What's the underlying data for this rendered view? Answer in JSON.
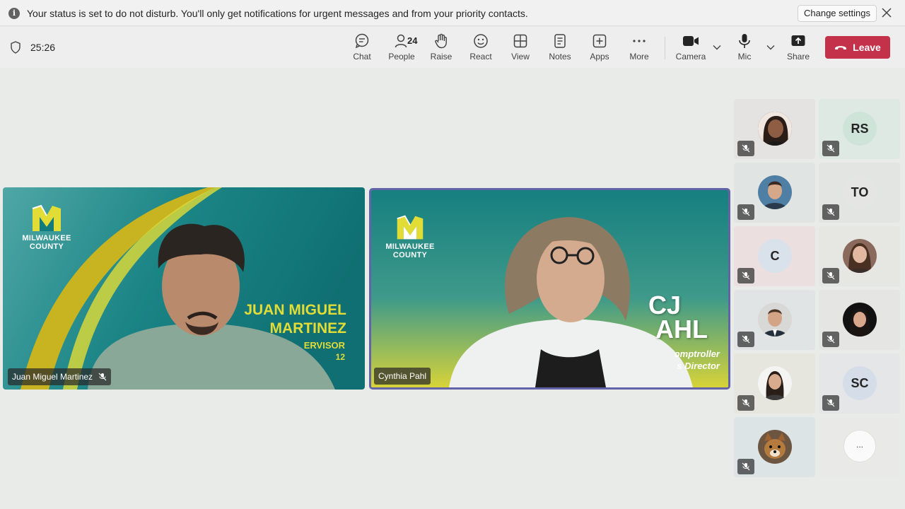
{
  "banner": {
    "message": "Your status is set to do not disturb. You'll only get notifications for urgent messages and from your priority contacts.",
    "change_settings_label": "Change settings",
    "info_icon": "i"
  },
  "toolbar": {
    "timer": "25:26",
    "items": [
      {
        "label": "Chat",
        "icon": "chat-icon"
      },
      {
        "label": "People",
        "icon": "people-icon",
        "count": "24"
      },
      {
        "label": "Raise",
        "icon": "raise-hand-icon"
      },
      {
        "label": "React",
        "icon": "smile-icon"
      },
      {
        "label": "View",
        "icon": "grid-icon"
      },
      {
        "label": "Notes",
        "icon": "notes-icon"
      },
      {
        "label": "Apps",
        "icon": "plus-icon"
      },
      {
        "label": "More",
        "icon": "ellipsis-icon"
      },
      {
        "label": "Camera",
        "icon": "camera-icon"
      },
      {
        "label": "Mic",
        "icon": "mic-icon"
      },
      {
        "label": "Share",
        "icon": "share-icon"
      }
    ],
    "leave_label": "Leave"
  },
  "stage": {
    "tiles": [
      {
        "name": "Juan Miguel Martinez",
        "logo_text": "MILWAUKEE\nCOUNTY",
        "overlay_line1": "JUAN MIGUEL",
        "overlay_line2": "MARTINEZ",
        "overlay_sub": "ERVISOR",
        "overlay_sub2": "12",
        "muted": true
      },
      {
        "name": "Cynthia Pahl",
        "logo_text": "MILWAUKEE\nCOUNTY",
        "overlay_line1": "CJ",
        "overlay_line2": "AHL",
        "overlay_sub": "omptroller",
        "overlay_sub2": "s Director",
        "active_speaker": true
      }
    ]
  },
  "participants": [
    {
      "type": "photo",
      "muted": true
    },
    {
      "type": "initials",
      "initials": "RS",
      "muted": true
    },
    {
      "type": "photo",
      "muted": true
    },
    {
      "type": "initials",
      "initials": "TO",
      "muted": true
    },
    {
      "type": "initials",
      "initials": "C",
      "muted": true
    },
    {
      "type": "photo",
      "muted": true
    },
    {
      "type": "photo",
      "muted": true
    },
    {
      "type": "photo",
      "muted": true
    },
    {
      "type": "photo",
      "muted": true
    },
    {
      "type": "initials",
      "initials": "SC",
      "muted": true
    },
    {
      "type": "photo",
      "muted": true
    },
    {
      "type": "overflow",
      "label": "..."
    }
  ],
  "colors": {
    "leave": "#c4314b",
    "active_border": "#6264a7",
    "county_teal": "#127b7c",
    "county_yellow": "#e2dc36"
  }
}
